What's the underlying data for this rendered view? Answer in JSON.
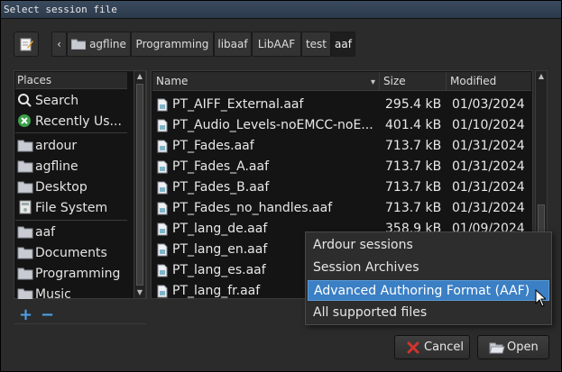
{
  "window": {
    "title": "Select session file"
  },
  "breadcrumbs": [
    "agfline",
    "Programming",
    "libaaf",
    "LibAAF",
    "test",
    "aaf"
  ],
  "places": {
    "header": "Places",
    "system": [
      {
        "label": "Search",
        "icon": "search-icon"
      },
      {
        "label": "Recently Us...",
        "icon": "recent-icon"
      }
    ],
    "locations": [
      {
        "label": "ardour",
        "icon": "folder-icon"
      },
      {
        "label": "agfline",
        "icon": "folder-icon"
      },
      {
        "label": "Desktop",
        "icon": "folder-icon"
      },
      {
        "label": "File System",
        "icon": "drive-icon"
      }
    ],
    "bookmarks": [
      {
        "label": "aaf",
        "icon": "folder-icon"
      },
      {
        "label": "Documents",
        "icon": "folder-icon"
      },
      {
        "label": "Programming",
        "icon": "folder-icon"
      },
      {
        "label": "Music",
        "icon": "folder-icon"
      }
    ],
    "add_label": "+",
    "remove_label": "−"
  },
  "files": {
    "columns": {
      "name": "Name",
      "size": "Size",
      "modified": "Modified"
    },
    "rows": [
      {
        "name": "PT_AIFF_External.aaf",
        "size": "295.4 kB",
        "modified": "01/03/2024"
      },
      {
        "name": "PT_Audio_Levels-noEMCC-noE...",
        "size": "401.4 kB",
        "modified": "01/10/2024"
      },
      {
        "name": "PT_Fades.aaf",
        "size": "713.7 kB",
        "modified": "01/31/2024"
      },
      {
        "name": "PT_Fades_A.aaf",
        "size": "713.7 kB",
        "modified": "01/31/2024"
      },
      {
        "name": "PT_Fades_B.aaf",
        "size": "713.7 kB",
        "modified": "01/31/2024"
      },
      {
        "name": "PT_Fades_no_handles.aaf",
        "size": "713.7 kB",
        "modified": "01/31/2024"
      },
      {
        "name": "PT_lang_de.aaf",
        "size": "358.9 kB",
        "modified": "01/09/2024"
      },
      {
        "name": "PT_lang_en.aaf",
        "size": "",
        "modified": ""
      },
      {
        "name": "PT_lang_es.aaf",
        "size": "",
        "modified": ""
      },
      {
        "name": "PT_lang_fr.aaf",
        "size": "",
        "modified": ""
      }
    ]
  },
  "filter_menu": {
    "options": [
      "Ardour sessions",
      "Session Archives",
      "Advanced Authoring Format (AAF)",
      "All supported files"
    ],
    "selected": "Advanced Authoring Format (AAF)"
  },
  "buttons": {
    "cancel": "Cancel",
    "open": "Open"
  },
  "colors": {
    "accent": "#3b7fc4",
    "cancel_icon": "#d0342c",
    "add_remove": "#4ea0e8"
  }
}
